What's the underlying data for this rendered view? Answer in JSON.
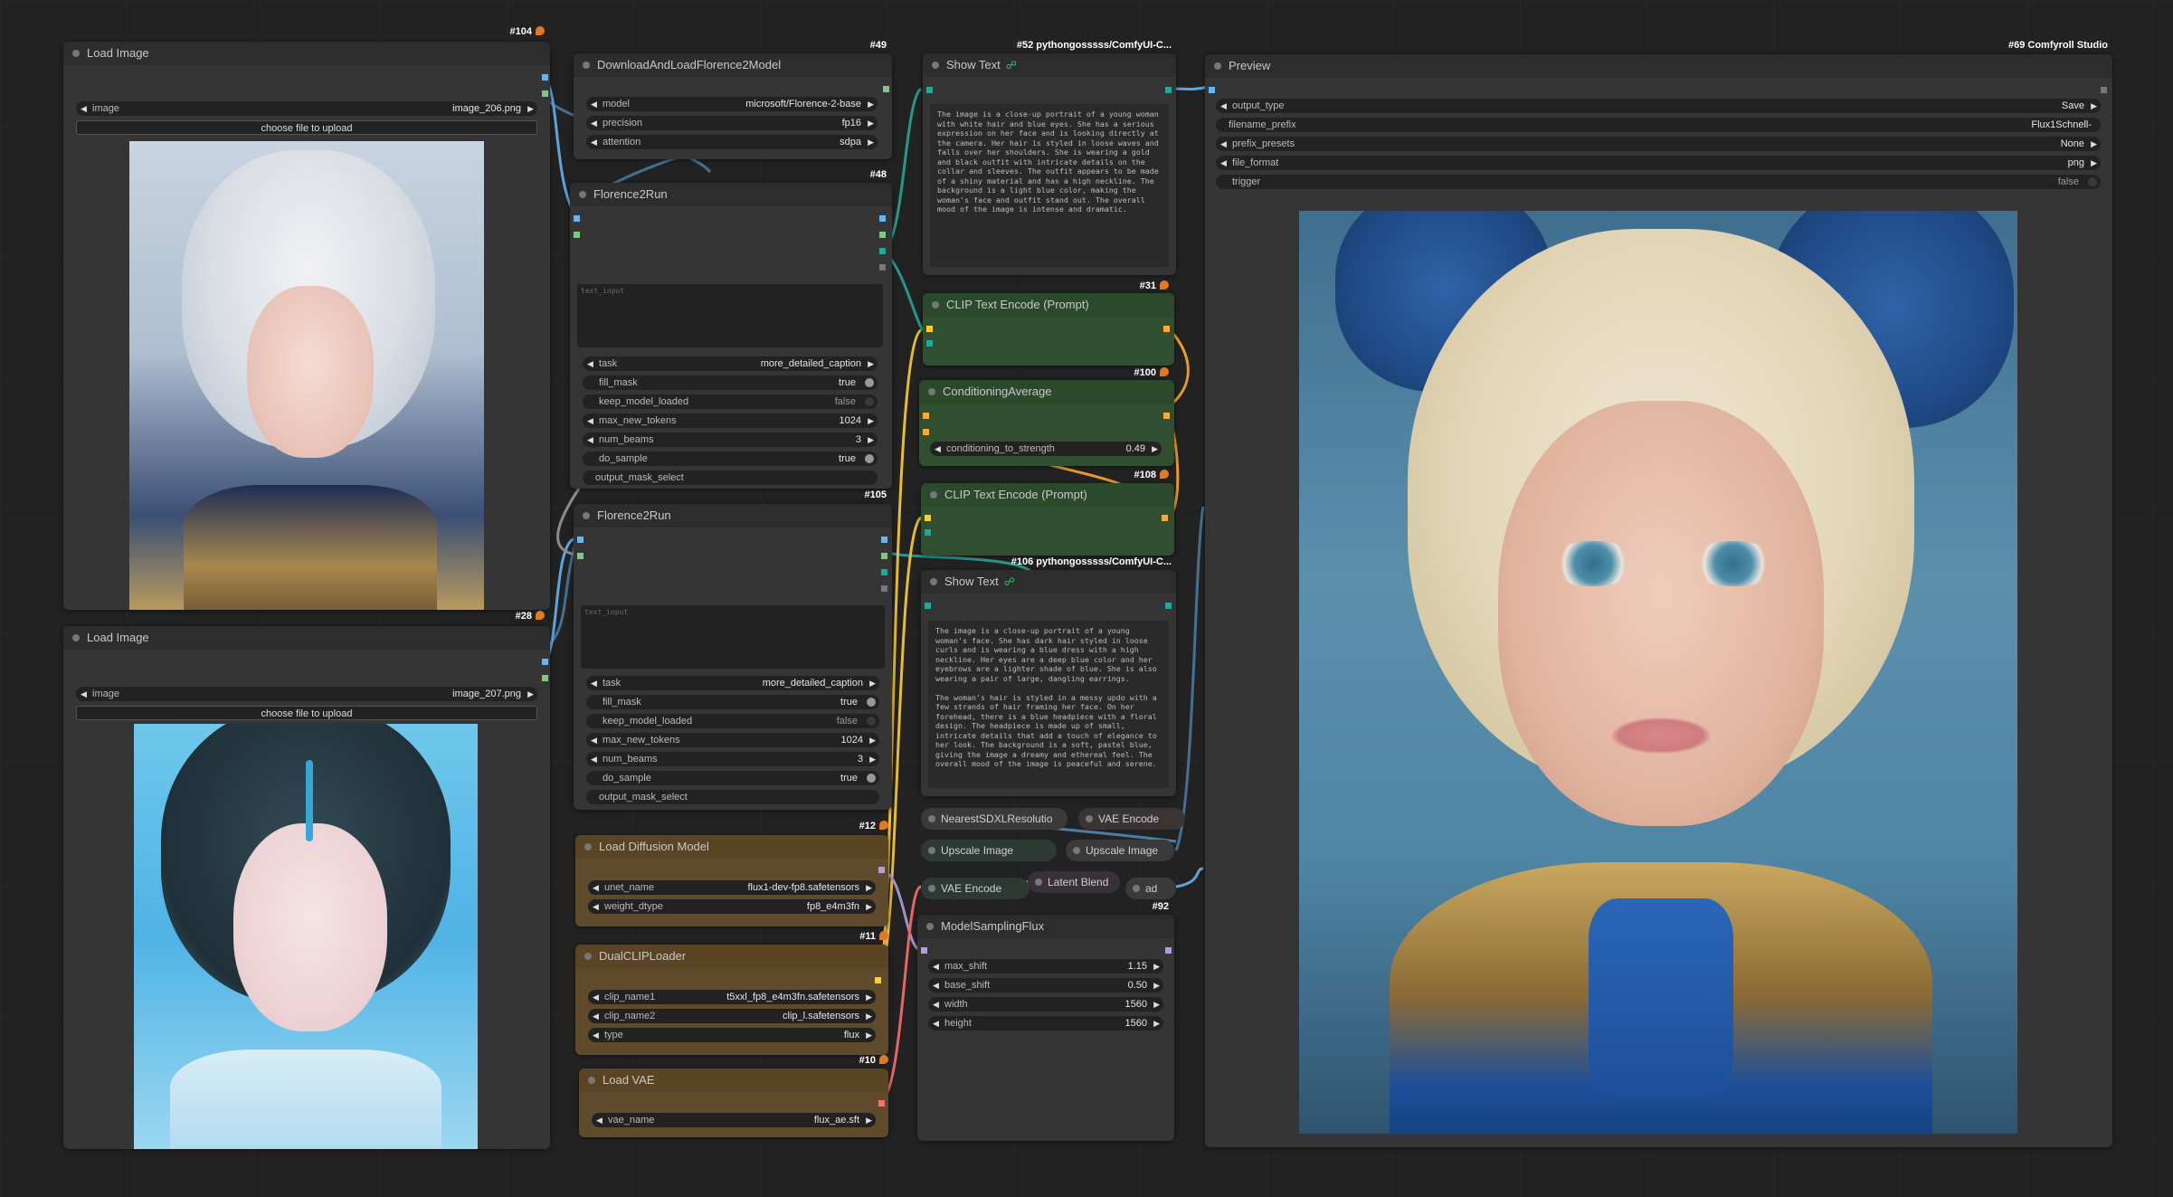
{
  "app": {
    "name": "ComfyUI"
  },
  "colors": {
    "canvas": "#222222",
    "node_bg": "#353535",
    "node_header": "#2d2d2d",
    "green_node": "#2f4f30",
    "brown_node": "#5f4b2c",
    "link_image": "#64b5f6",
    "link_string": "#26a69a",
    "link_conditioning": "#ffa931",
    "link_latent": "#ff9cf9",
    "link_model": "#b39ddb",
    "link_vae": "#ff6e6e"
  },
  "nodes": {
    "load_image_1": {
      "title": "Load Image",
      "id": "#104",
      "image_label": "image",
      "image_value": "image_206.png",
      "upload": "choose file to upload"
    },
    "load_image_2": {
      "title": "Load Image",
      "id": "#28",
      "image_label": "image",
      "image_value": "image_207.png",
      "upload": "choose file to upload"
    },
    "florence_loader": {
      "title": "DownloadAndLoadFlorence2Model",
      "id": "#49",
      "widgets": [
        {
          "label": "model",
          "value": "microsoft/Florence-2-base"
        },
        {
          "label": "precision",
          "value": "fp16"
        },
        {
          "label": "attention",
          "value": "sdpa"
        }
      ]
    },
    "florence_run_1": {
      "title": "Florence2Run",
      "id": "#48",
      "text_input": "text_input",
      "widgets": [
        {
          "label": "task",
          "value": "more_detailed_caption"
        },
        {
          "label": "fill_mask",
          "value": "true"
        },
        {
          "label": "keep_model_loaded",
          "value": "false"
        },
        {
          "label": "max_new_tokens",
          "value": "1024"
        },
        {
          "label": "num_beams",
          "value": "3"
        },
        {
          "label": "do_sample",
          "value": "true"
        },
        {
          "label": "output_mask_select",
          "value": ""
        }
      ]
    },
    "florence_run_2": {
      "title": "Florence2Run",
      "id": "#105",
      "text_input": "text_input",
      "widgets": [
        {
          "label": "task",
          "value": "more_detailed_caption"
        },
        {
          "label": "fill_mask",
          "value": "true"
        },
        {
          "label": "keep_model_loaded",
          "value": "false"
        },
        {
          "label": "max_new_tokens",
          "value": "1024"
        },
        {
          "label": "num_beams",
          "value": "3"
        },
        {
          "label": "do_sample",
          "value": "true"
        },
        {
          "label": "output_mask_select",
          "value": ""
        }
      ]
    },
    "show_text_1": {
      "title": "Show Text",
      "id": "#52 pythongosssss/ComfyUI-C...",
      "text": "The image is a close-up portrait of a young woman with white hair and blue eyes. She has a serious expression on her face and is looking directly at the camera. Her hair is styled in loose waves and falls over her shoulders. She is wearing a gold and black outfit with intricate details on the collar and sleeves. The outfit appears to be made of a shiny material and has a high neckline. The background is a light blue color, making the woman's face and outfit stand out. The overall mood of the image is intense and dramatic."
    },
    "show_text_2": {
      "title": "Show Text",
      "id": "#106 pythongosssss/ComfyUI-C...",
      "text": "The image is a close-up portrait of a young woman's face. She has dark hair styled in loose curls and is wearing a blue dress with a high neckline. Her eyes are a deep blue color and her eyebrows are a lighter shade of blue. She is also wearing a pair of large, dangling earrings.\n\nThe woman's hair is styled in a messy updo with a few strands of hair framing her face. On her forehead, there is a blue headpiece with a floral design. The headpiece is made up of small, intricate details that add a touch of elegance to her look. The background is a soft, pastel blue, giving the image a dreamy and ethereal feel. The overall mood of the image is peaceful and serene."
    },
    "clip_encode_1": {
      "title": "CLIP Text Encode (Prompt)",
      "id": "#31"
    },
    "cond_avg": {
      "title": "ConditioningAverage",
      "id": "#100",
      "widgets": [
        {
          "label": "conditioning_to_strength",
          "value": "0.49"
        }
      ]
    },
    "clip_encode_2": {
      "title": "CLIP Text Encode (Prompt)",
      "id": "#108"
    },
    "load_diffusion": {
      "title": "Load Diffusion Model",
      "id": "#12",
      "widgets": [
        {
          "label": "unet_name",
          "value": "flux1-dev-fp8.safetensors"
        },
        {
          "label": "weight_dtype",
          "value": "fp8_e4m3fn"
        }
      ]
    },
    "dual_clip": {
      "title": "DualCLIPLoader",
      "id": "#11",
      "widgets": [
        {
          "label": "clip_name1",
          "value": "t5xxl_fp8_e4m3fn.safetensors"
        },
        {
          "label": "clip_name2",
          "value": "clip_l.safetensors"
        },
        {
          "label": "type",
          "value": "flux"
        }
      ]
    },
    "load_vae": {
      "title": "Load VAE",
      "id": "#10",
      "widgets": [
        {
          "label": "vae_name",
          "value": "flux_ae.sft"
        }
      ]
    },
    "nearest_sdxl": {
      "title": "NearestSDXLResolutio"
    },
    "vae_encode_1": {
      "title": "VAE Encode"
    },
    "upscale_1": {
      "title": "Upscale Image"
    },
    "upscale_2": {
      "title": "Upscale Image"
    },
    "vae_encode_2": {
      "title": "VAE Encode"
    },
    "latent_blend": {
      "title": "Latent Blend"
    },
    "ad": {
      "title": "ad"
    },
    "model_sampling": {
      "title": "ModelSamplingFlux",
      "id": "#92",
      "widgets": [
        {
          "label": "max_shift",
          "value": "1.15"
        },
        {
          "label": "base_shift",
          "value": "0.50"
        },
        {
          "label": "width",
          "value": "1560"
        },
        {
          "label": "height",
          "value": "1560"
        }
      ]
    },
    "preview": {
      "title": "Preview",
      "id": "#69 Comfyroll Studio",
      "widgets": [
        {
          "label": "output_type",
          "value": "Save"
        },
        {
          "label": "filename_prefix",
          "value": "Flux1Schnell-"
        },
        {
          "label": "prefix_presets",
          "value": "None"
        },
        {
          "label": "file_format",
          "value": "png"
        },
        {
          "label": "trigger",
          "value": "false"
        }
      ]
    }
  }
}
